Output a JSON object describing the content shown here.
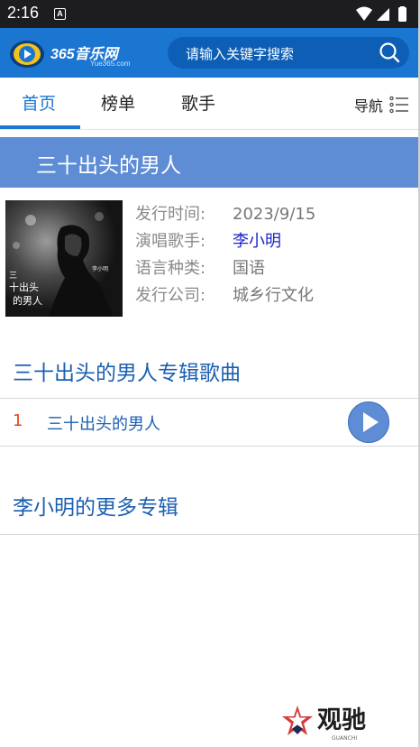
{
  "status_bar": {
    "time": "2:16",
    "notification_letter": "A"
  },
  "header": {
    "logo_name": "365音乐网",
    "logo_url": "Yue365.com",
    "search_placeholder": "请输入关键字搜索"
  },
  "nav": {
    "tabs": [
      {
        "label": "首页",
        "active": true
      },
      {
        "label": "榜单",
        "active": false
      },
      {
        "label": "歌手",
        "active": false
      }
    ],
    "menu_label": "导航"
  },
  "album": {
    "title": "三十出头的男人",
    "info": [
      {
        "label": "发行时间:",
        "value": "2023/9/15"
      },
      {
        "label": "演唱歌手:",
        "value": "李小明"
      },
      {
        "label": "语言种类:",
        "value": "国语"
      },
      {
        "label": "发行公司:",
        "value": "城乡行文化"
      }
    ],
    "cover_text": {
      "line1": "三",
      "line2": "十出头",
      "line3": "的男人",
      "artist": "李小明"
    }
  },
  "songs_section": {
    "title": "三十出头的男人专辑歌曲",
    "songs": [
      {
        "index": "1",
        "name": "三十出头的男人"
      }
    ]
  },
  "more_section": {
    "title": "李小明的更多专辑"
  },
  "watermark": {
    "text": "观驰",
    "sub": "GUANCHI"
  },
  "colors": {
    "brand_blue": "#1b76d2",
    "album_bar": "#5e8dd6",
    "section_title": "#1b5fb2",
    "index_red": "#e64a19",
    "artist_link": "#1e23c8"
  }
}
